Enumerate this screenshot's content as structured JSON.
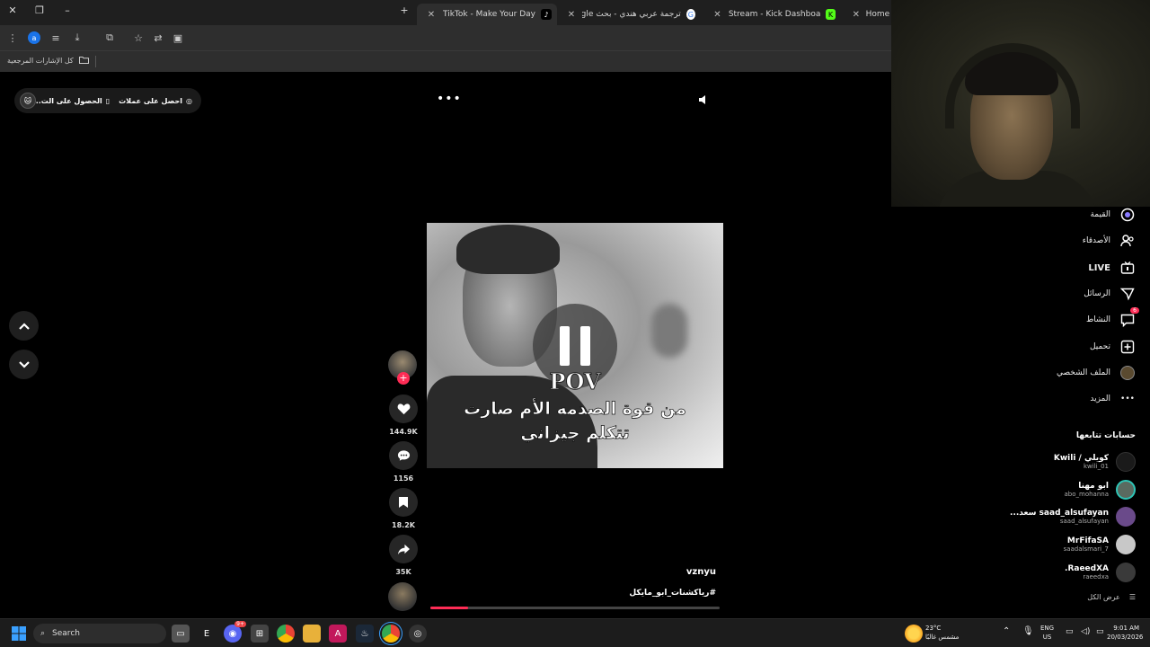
{
  "browser": {
    "tabs": [
      {
        "title": "TikTok - Make Your Day",
        "active": true
      },
      {
        "title": "ترجمة عربي هندي - بحث Google",
        "active": false
      },
      {
        "title": "Stream - Kick Dashboard",
        "active": false
      },
      {
        "title": "Home / X",
        "active": false
      }
    ],
    "bookmarks_label": "كل الإشارات المرجعية",
    "profile_letter": "a"
  },
  "promo": {
    "get_coins": "احصل على عملات",
    "get_app": "الحصول على الت..."
  },
  "video": {
    "overlay_pov": "POV",
    "caption_line1": "من قوة الصدمه الأم صارت",
    "caption_line2": "تتكلم جيزاني",
    "progress_fraction": 0.13
  },
  "actions": {
    "likes": "144.9K",
    "comments": "1156",
    "saves": "18.2K",
    "shares": "35K"
  },
  "post": {
    "author": "vznyu",
    "hashtag": "#رياكشنات_ابو_مايكل"
  },
  "sidebar": {
    "items": [
      {
        "label": "القيمة",
        "icon": "explore-icon"
      },
      {
        "label": "الأصدقاء",
        "icon": "friends-icon"
      },
      {
        "label": "LIVE",
        "icon": "live-icon"
      },
      {
        "label": "الرسائل",
        "icon": "messages-icon"
      },
      {
        "label": "النشاط",
        "icon": "activity-icon",
        "badge": "6"
      },
      {
        "label": "تحميل",
        "icon": "upload-icon"
      },
      {
        "label": "الملف الشخصي",
        "icon": "profile-icon"
      },
      {
        "label": "المزيد",
        "icon": "more-icon"
      }
    ],
    "following_header": "حسابات تتابعها",
    "following": [
      {
        "name": "كويلي / Kwili",
        "handle": "kwili_01"
      },
      {
        "name": "ابو مهنا",
        "handle": "abo_mohanna"
      },
      {
        "name": "saad_alsufayan سعد...",
        "handle": "saad_alsufayan"
      },
      {
        "name": "MrFifaSA",
        "handle": "saadalsmari_7"
      },
      {
        "name": "RaeedXA.",
        "handle": "raeedxa"
      }
    ],
    "see_all": "عرض الكل"
  },
  "taskbar": {
    "search_placeholder": "Search",
    "weather_temp": "23°C",
    "weather_desc": "مشمس غالبًا",
    "lang_1": "ENG",
    "lang_2": "US",
    "time": "9:01 AM",
    "date": "20/03/2026",
    "discord_badge": "9+"
  }
}
